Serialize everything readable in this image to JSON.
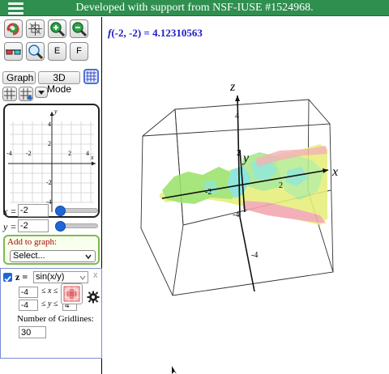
{
  "header": {
    "title": "Developed with support from NSF-IUSE #1524968.",
    "menu_icon": "hamburger-menu-icon"
  },
  "toolbar": {
    "row1": [
      "reset-view-icon",
      "rotate-icon",
      "zoom-in-icon",
      "zoom-out-icon"
    ],
    "row2": [
      "3d-glasses-icon",
      "zoom-fit-icon"
    ],
    "e_label": "E",
    "f_label": "F"
  },
  "mode": {
    "graph_label": "Graph",
    "mode3d_label": "3D Mode"
  },
  "mini_graph": {
    "x_ticks": [
      "-4",
      "-2",
      "2",
      "4"
    ],
    "y_ticks": [
      "4",
      "2",
      "-2",
      "-4"
    ],
    "x_label": "x",
    "y_label": "y"
  },
  "point": {
    "x_label": "x =",
    "x_value": "-2",
    "y_label": "y =",
    "y_value": "-2"
  },
  "add_to_graph": {
    "label": "Add to graph:",
    "select_value": "Select..."
  },
  "function": {
    "z_label": "z =",
    "expression": "sin(x/y)",
    "close_label": "x",
    "x_min": "-4",
    "x_range_label": "≤ x ≤",
    "y_min": "-4",
    "y_range_label": "≤ y ≤",
    "y_max": "4",
    "gridlines_label": "Number of Gridlines:",
    "gridlines_value": "30"
  },
  "plot": {
    "readout_f": "f",
    "readout_text": "(-2, -2) = 4.12310563",
    "axis_x": "x",
    "axis_y": "y",
    "axis_z": "z",
    "tick_x_neg": "-2",
    "tick_x_pos": "2",
    "tick_y_pos": "2",
    "tick_y_neg": "-4",
    "tick_z_pos": "4",
    "tick_z_neg": "-4"
  },
  "colors": {
    "header_bg": "#2f8f4f",
    "readout": "#1a1acc",
    "surface_green": "#9be36b",
    "surface_yellow": "#e6ef7a",
    "surface_cyan": "#7fe3d9",
    "surface_pink": "#f2a6b0"
  }
}
